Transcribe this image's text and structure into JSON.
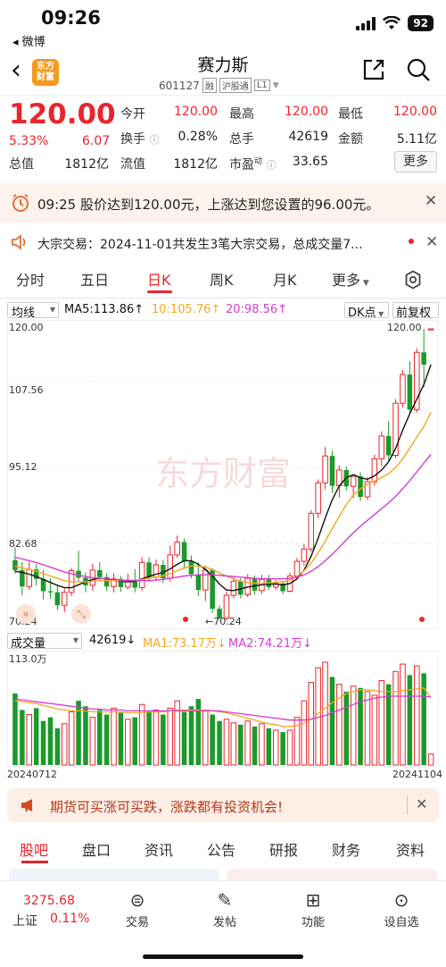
{
  "status": {
    "time": "09:26",
    "back_app": "◂ 微博",
    "battery": "92"
  },
  "header": {
    "logo": "东方\n财富",
    "stock_name": "赛力斯",
    "code": "601127",
    "tags": [
      "融",
      "沪股通",
      "L1"
    ]
  },
  "quote": {
    "price": "120.00",
    "pct": "5.33%",
    "change": "6.07",
    "rows": [
      {
        "l1": "今开",
        "v1": "120.00",
        "l2": "最高",
        "v2": "120.00",
        "l3": "最低",
        "v3": "120.00"
      },
      {
        "l1": "换手",
        "v1": "0.28%",
        "l2": "总手",
        "v2": "42619",
        "l3": "金额",
        "v3": "5.11亿"
      },
      {
        "l1": "流值",
        "v1": "1812亿",
        "l2": "市盈",
        "l2sup": "动",
        "v2": "33.65"
      }
    ],
    "total_value_label": "总值",
    "total_value": "1812亿",
    "more_label": "更多"
  },
  "alert": {
    "text": "09:25 股价达到120.00元，上涨达到您设置的96.00元。"
  },
  "block_trade": {
    "text": "大宗交易：2024-11-01共发生3笔大宗交易，总成交量7..."
  },
  "tabs": [
    "分时",
    "五日",
    "日K",
    "周K",
    "月K",
    "更多"
  ],
  "kchart": {
    "indicator": "均线",
    "ma5": "MA5:113.86↑",
    "ma10": "10:105.76↑",
    "ma20": "20:98.56↑",
    "dk_label": "DK点",
    "adjust_label": "前复权",
    "y_ticks": [
      "120.00",
      "107.56",
      "95.12",
      "82.68",
      "70.24"
    ],
    "high_label": "120.00",
    "low_label": "←70.24",
    "watermark": "东方财富"
  },
  "volume": {
    "indicator": "成交量",
    "value": "42619↓",
    "ma1": "MA1:73.17万↓",
    "ma2": "MA2:74.21万↓",
    "max_label": "113.0万",
    "start_date": "20240712",
    "end_date": "20241104"
  },
  "promo": {
    "text": "期货可买涨可买跌，涨跌都有投资机会!"
  },
  "bottom_tabs": [
    "股吧",
    "盘口",
    "资讯",
    "公告",
    "研报",
    "财务",
    "资料"
  ],
  "bottom_bar": {
    "index_value": "3275.68",
    "index_name": "上证",
    "index_pct": "0.11%",
    "items": [
      "交易",
      "发帖",
      "功能",
      "设自选"
    ]
  },
  "colors": {
    "up": "#e8262b",
    "down": "#1a9a2a",
    "ma5": "#111111",
    "ma10": "#f5a623",
    "ma20": "#d63ad6"
  },
  "chart_data": {
    "type": "candlestick",
    "ylim": [
      70.24,
      120.0
    ],
    "candles": [
      [
        80.5,
        82.7,
        78.2,
        78.8
      ],
      [
        78.8,
        80.2,
        74.5,
        76.0
      ],
      [
        76.0,
        80.2,
        75.4,
        78.9
      ],
      [
        78.9,
        79.8,
        76.2,
        77.3
      ],
      [
        77.3,
        78.8,
        73.8,
        75.2
      ],
      [
        75.2,
        77.4,
        73.9,
        75.0
      ],
      [
        75.0,
        76.4,
        72.0,
        72.8
      ],
      [
        72.8,
        75.6,
        71.6,
        75.0
      ],
      [
        75.0,
        79.2,
        74.4,
        78.7
      ],
      [
        78.7,
        82.1,
        76.9,
        77.5
      ],
      [
        77.5,
        78.4,
        75.0,
        76.2
      ],
      [
        76.2,
        79.9,
        75.3,
        78.8
      ],
      [
        78.8,
        80.2,
        77.0,
        77.6
      ],
      [
        77.6,
        78.3,
        75.2,
        76.0
      ],
      [
        76.0,
        78.3,
        75.0,
        77.3
      ],
      [
        77.3,
        77.8,
        75.1,
        75.9
      ],
      [
        75.9,
        78.2,
        75.5,
        77.1
      ],
      [
        77.1,
        79.0,
        75.0,
        75.8
      ],
      [
        75.8,
        81.0,
        75.2,
        80.1
      ],
      [
        80.1,
        81.0,
        77.0,
        77.6
      ],
      [
        77.6,
        80.6,
        77.0,
        79.7
      ],
      [
        79.7,
        80.5,
        76.6,
        77.4
      ],
      [
        77.4,
        83.0,
        76.8,
        81.4
      ],
      [
        81.4,
        84.7,
        80.9,
        83.6
      ],
      [
        83.6,
        84.2,
        79.0,
        80.3
      ],
      [
        80.3,
        81.3,
        77.4,
        78.1
      ],
      [
        78.1,
        80.1,
        74.4,
        75.4
      ],
      [
        75.4,
        79.6,
        73.5,
        78.8
      ],
      [
        78.8,
        79.1,
        71.5,
        72.2
      ],
      [
        72.2,
        72.8,
        70.3,
        70.6
      ],
      [
        70.6,
        75.2,
        70.2,
        74.5
      ],
      [
        74.5,
        77.7,
        74.0,
        76.9
      ],
      [
        76.9,
        77.4,
        74.0,
        74.6
      ],
      [
        74.6,
        78.1,
        74.2,
        77.4
      ],
      [
        77.4,
        77.9,
        74.6,
        75.3
      ],
      [
        75.3,
        78.0,
        74.7,
        77.2
      ],
      [
        77.2,
        78.0,
        75.4,
        75.9
      ],
      [
        75.9,
        77.1,
        75.4,
        76.5
      ],
      [
        76.5,
        76.9,
        74.7,
        75.2
      ],
      [
        75.2,
        78.4,
        75.0,
        77.8
      ],
      [
        77.8,
        80.9,
        77.4,
        80.3
      ],
      [
        80.3,
        83.3,
        79.6,
        82.4
      ],
      [
        82.4,
        89.0,
        81.9,
        88.5
      ],
      [
        88.5,
        94.3,
        87.7,
        93.7
      ],
      [
        93.7,
        99.8,
        92.6,
        98.3
      ],
      [
        98.3,
        99.2,
        92.0,
        93.2
      ],
      [
        93.2,
        96.7,
        91.2,
        95.9
      ],
      [
        95.9,
        96.5,
        92.4,
        93.1
      ],
      [
        93.1,
        95.1,
        91.1,
        94.8
      ],
      [
        94.8,
        95.5,
        90.6,
        91.3
      ],
      [
        91.3,
        94.7,
        90.8,
        93.9
      ],
      [
        93.9,
        98.5,
        93.2,
        97.8
      ],
      [
        97.8,
        102.5,
        96.6,
        101.7
      ],
      [
        101.7,
        104.2,
        97.5,
        98.4
      ],
      [
        98.4,
        108.0,
        97.9,
        107.3
      ],
      [
        107.3,
        113.0,
        106.6,
        112.2
      ],
      [
        112.2,
        114.5,
        105.5,
        106.2
      ],
      [
        106.2,
        116.7,
        105.7,
        116.0
      ],
      [
        116.0,
        120.0,
        110.0,
        113.9
      ],
      [
        120.0,
        120.0,
        120.0,
        120.0
      ]
    ],
    "ma5": [
      78.6,
      78.4,
      78.1,
      77.7,
      77.2,
      76.7,
      76.2,
      75.8,
      75.8,
      76.3,
      76.8,
      77.2,
      77.4,
      77.3,
      77.1,
      76.9,
      76.8,
      76.9,
      77.3,
      77.7,
      78.1,
      78.4,
      79.0,
      79.8,
      80.4,
      80.4,
      79.8,
      78.9,
      77.8,
      76.4,
      75.4,
      75.3,
      75.6,
      75.9,
      76.1,
      76.3,
      76.4,
      76.4,
      76.3,
      76.5,
      77.3,
      78.8,
      81.2,
      84.2,
      87.7,
      90.8,
      93.2,
      94.6,
      95.1,
      94.6,
      94.3,
      94.9,
      95.9,
      97.3,
      99.6,
      102.7,
      105.5,
      108.0,
      110.5,
      113.9
    ],
    "ma10": [
      79.5,
      79.2,
      78.9,
      78.6,
      78.2,
      77.8,
      77.4,
      77.0,
      76.8,
      76.8,
      76.8,
      76.9,
      77.0,
      77.0,
      77.0,
      77.0,
      77.0,
      77.1,
      77.2,
      77.4,
      77.6,
      77.8,
      78.2,
      78.7,
      79.2,
      79.5,
      79.5,
      79.3,
      78.9,
      78.3,
      77.8,
      77.3,
      76.9,
      76.7,
      76.6,
      76.5,
      76.6,
      76.7,
      76.8,
      77.1,
      77.7,
      78.7,
      80.0,
      81.7,
      83.7,
      85.9,
      88.0,
      90.0,
      91.6,
      92.7,
      93.4,
      94.0,
      94.6,
      95.3,
      96.3,
      97.8,
      99.6,
      101.5,
      103.3,
      105.76
    ],
    "ma20": [
      81.0,
      80.7,
      80.4,
      80.1,
      79.7,
      79.3,
      78.9,
      78.5,
      78.2,
      77.9,
      77.7,
      77.5,
      77.4,
      77.3,
      77.2,
      77.1,
      77.0,
      77.0,
      77.0,
      77.0,
      77.1,
      77.2,
      77.4,
      77.6,
      77.8,
      77.9,
      78.0,
      78.0,
      78.0,
      77.9,
      77.8,
      77.7,
      77.6,
      77.5,
      77.4,
      77.3,
      77.3,
      77.3,
      77.3,
      77.4,
      77.6,
      78.0,
      78.6,
      79.4,
      80.4,
      81.5,
      82.7,
      84.0,
      85.2,
      86.3,
      87.3,
      88.3,
      89.3,
      90.3,
      91.4,
      92.7,
      94.1,
      95.6,
      97.1,
      98.56
    ],
    "volume_max": 113.0,
    "volumes": [
      78,
      60,
      55,
      62,
      48,
      52,
      40,
      45,
      58,
      70,
      64,
      52,
      60,
      55,
      62,
      57,
      50,
      52,
      66,
      58,
      60,
      55,
      62,
      70,
      58,
      64,
      72,
      60,
      55,
      48,
      50,
      46,
      44,
      48,
      42,
      45,
      40,
      38,
      36,
      38,
      52,
      70,
      90,
      106,
      112,
      96,
      88,
      80,
      86,
      84,
      80,
      76,
      92,
      88,
      102,
      110,
      98,
      108,
      100,
      12
    ],
    "vol_ma1": [
      70,
      69,
      68,
      67,
      65,
      63,
      61,
      60,
      59,
      59,
      59,
      58,
      58,
      58,
      58,
      58,
      57,
      57,
      57,
      58,
      58,
      58,
      59,
      60,
      60,
      60,
      60,
      60,
      59,
      58,
      57,
      55,
      53,
      51,
      49,
      47,
      45,
      44,
      42,
      42,
      43,
      46,
      50,
      56,
      62,
      68,
      73,
      78,
      80,
      82,
      82,
      81,
      80,
      80,
      80,
      81,
      82,
      83,
      84,
      73.17
    ],
    "vol_ma2": [
      72,
      71,
      70,
      69,
      68,
      67,
      66,
      65,
      64,
      63,
      62,
      61,
      61,
      60,
      60,
      60,
      59,
      59,
      59,
      59,
      59,
      59,
      59,
      59,
      59,
      59,
      59,
      59,
      59,
      59,
      58,
      57,
      56,
      55,
      54,
      53,
      52,
      51,
      50,
      49,
      49,
      49,
      50,
      52,
      54,
      57,
      60,
      63,
      66,
      69,
      71,
      73,
      74,
      75,
      75,
      75,
      75,
      75,
      75,
      74.21
    ]
  }
}
